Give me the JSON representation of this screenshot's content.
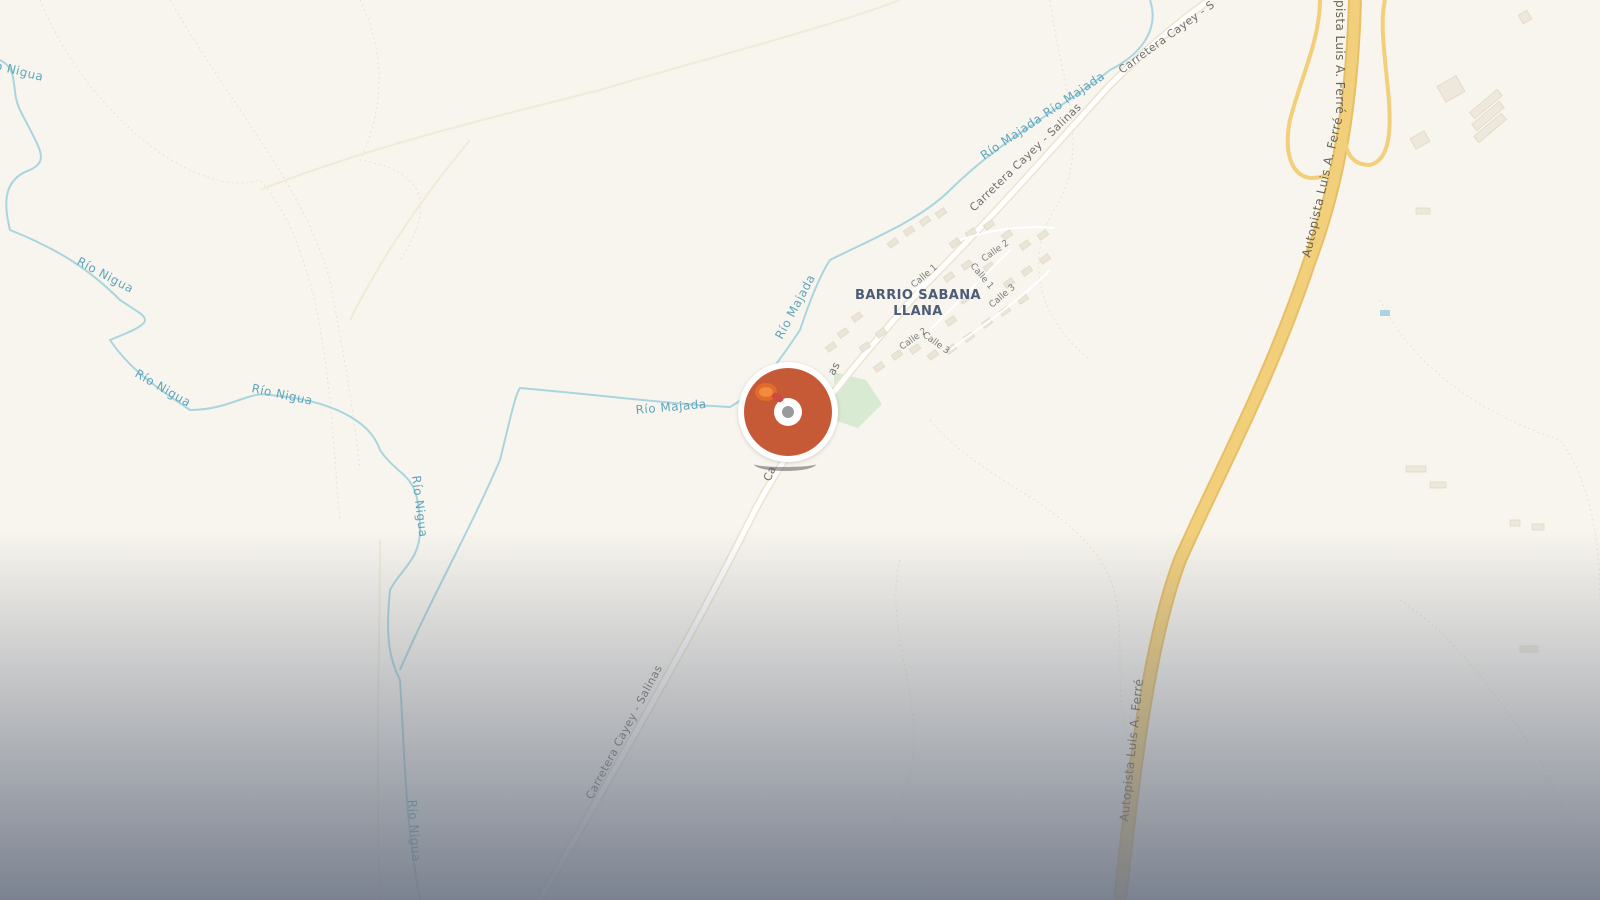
{
  "map": {
    "place": {
      "line1": "BARRIO SABANA",
      "line2": "LLANA"
    },
    "rivers": {
      "nigua_1": "Río Nigua",
      "nigua_2": "Río Nigua",
      "nigua_3": "Río Nigua",
      "nigua_4": "Río Nigua",
      "nigua_5": "Río Nigua",
      "majada_1": "Río Majada",
      "majada_2": "Río Majada",
      "majada_3": "Río Majada Río Majada"
    },
    "roads": {
      "cayey_1": "Carretera Cayey - Salinas",
      "cayey_2": "Carretera Cayey - Salinas",
      "cayey_3": "Carretera Cayey - S",
      "cayey_4": "Ca",
      "cayey_5": "as"
    },
    "highways": {
      "ferre_1": "Autopista Luis A. Ferré",
      "ferre_2": "Autopista Luis A. Ferré",
      "ferre_3": "pista Luis A. Ferré"
    },
    "streets": {
      "calle1_a": "Calle 1",
      "calle1_b": "Calle 1",
      "calle2_a": "Calle 2",
      "calle2_b": "Calle 2",
      "calle3_a": "Calle 3",
      "calle3_b": "Calle 3"
    },
    "colors": {
      "land": "#f8f5ee",
      "water": "#a9d5df",
      "highway": "#f2cf7a",
      "road": "#ffffff",
      "park": "#d9ead2",
      "marker": "#c65a36"
    },
    "marker_icon": "trailer-hitch-icon"
  }
}
